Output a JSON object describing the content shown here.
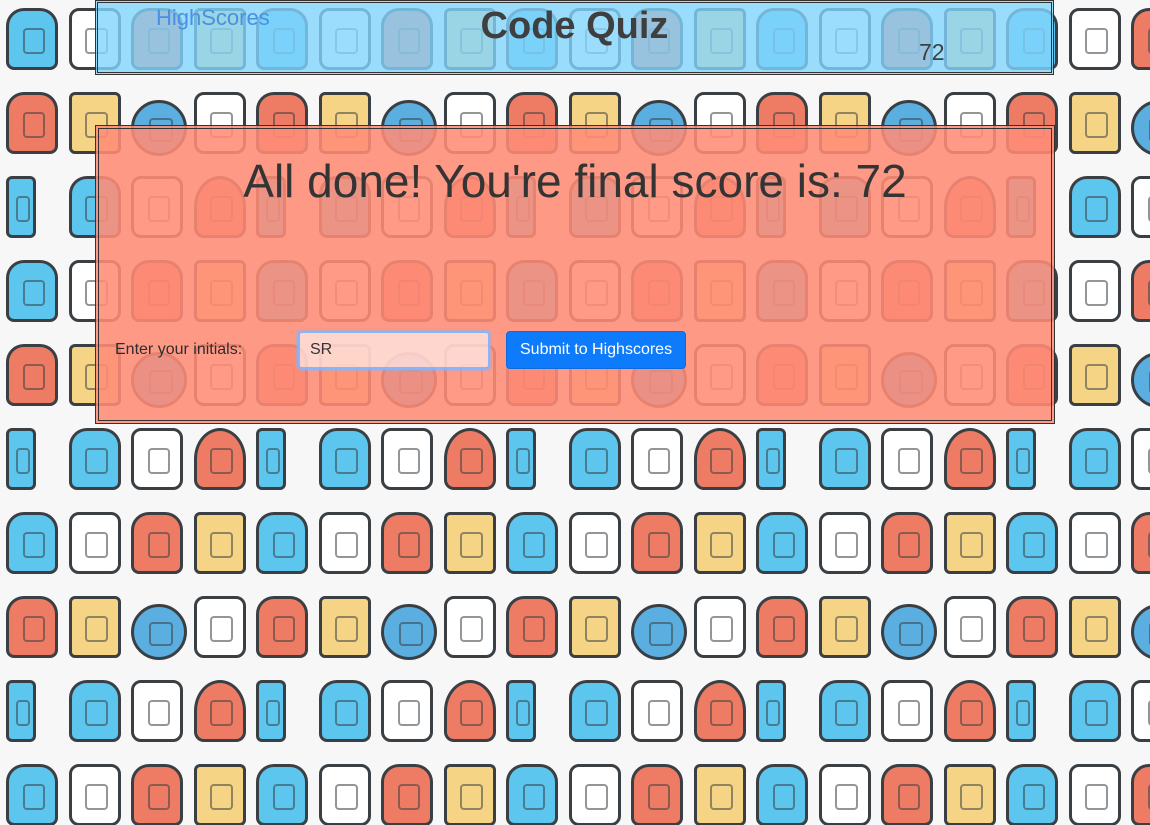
{
  "header": {
    "highscores_link": "HighScores",
    "title": "Code Quiz",
    "timer_value": "72"
  },
  "result": {
    "heading": "All done! You're final score is: 72",
    "initials_label": "Enter your initials:",
    "initials_value": "SR",
    "submit_label": "Submit to Highscores"
  },
  "colors": {
    "header_bg": "#82d4fc",
    "panel_bg": "#ff8c76",
    "submit_bg": "#0d7bfb",
    "link": "#4a90e2"
  },
  "background_pattern_icons": [
    "brain-head-icon",
    "brain-icon",
    "robot-bug-icon",
    "atom-book-icon",
    "user-gear-icon",
    "chip-icon",
    "globe-network-icon",
    "magnifier-grid-icon",
    "phone-battery-icon",
    "hand-network-icon",
    "monitor-gear-icon",
    "heart-circuit-icon"
  ]
}
